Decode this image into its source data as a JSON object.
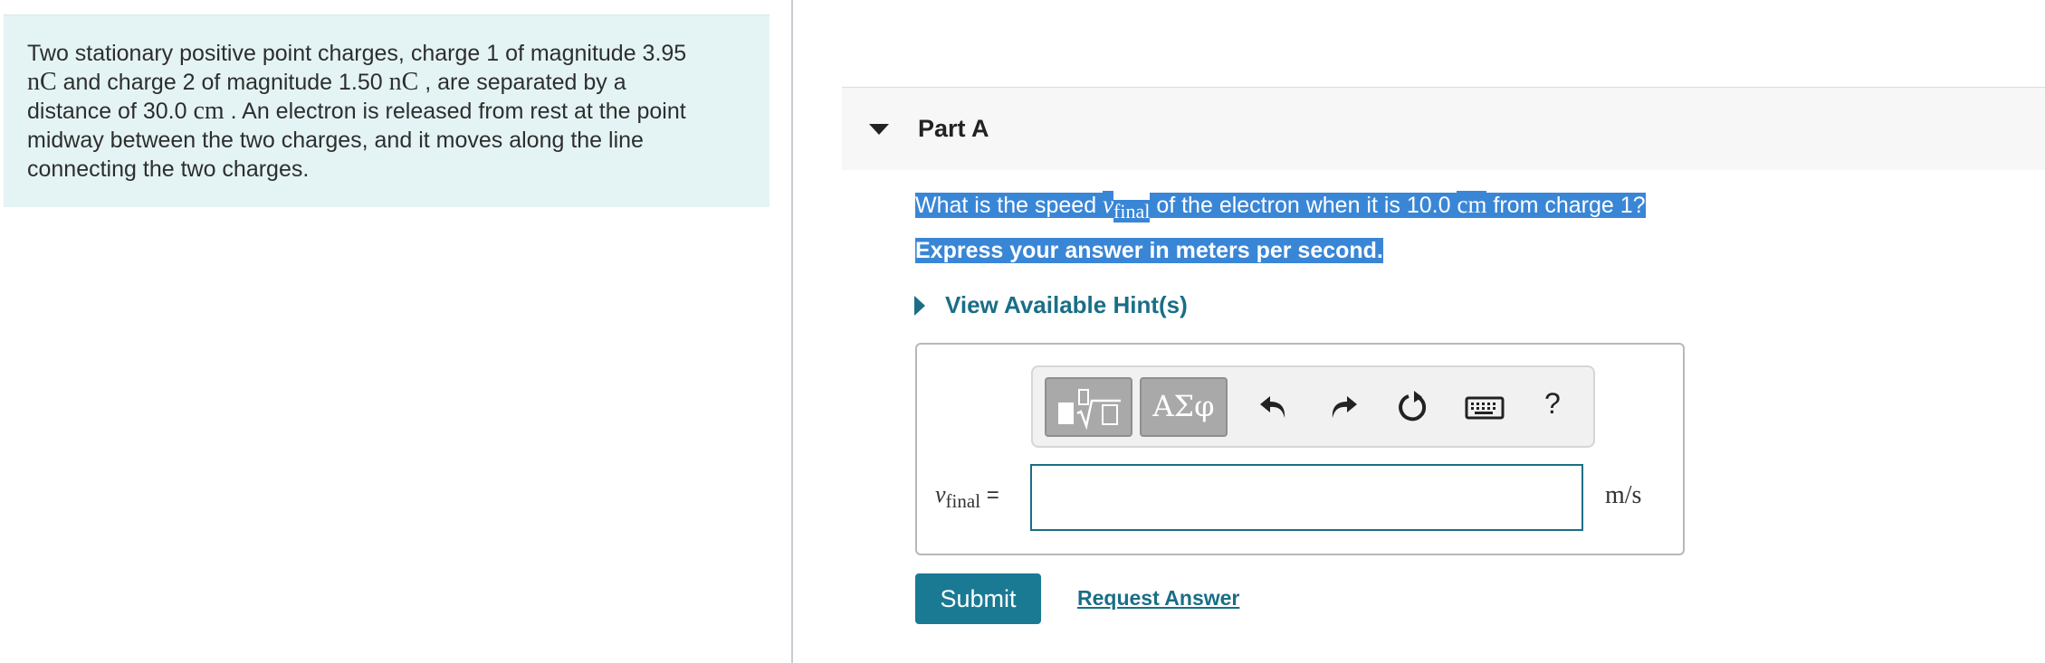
{
  "problem": {
    "text_1": "Two stationary positive point charges, charge 1 of magnitude 3.95",
    "unit_nC": "nC",
    "text_2": " and charge 2 of magnitude 1.50 ",
    "text_3": " , are separated by a",
    "text_4": "distance of 30.0 ",
    "unit_cm": "cm",
    "text_5": " . An electron is released from rest at the point",
    "text_6": "midway between the two charges, and it moves along the line",
    "text_7": "connecting the two charges."
  },
  "part": {
    "title": "Part A",
    "question_pre": "What is the speed ",
    "var_v": "v",
    "var_sub": "final",
    "question_mid": " of the electron when it is 10.0 ",
    "question_unit": "cm",
    "question_post": " from charge 1?",
    "express": "Express your answer in meters per second.",
    "hint_label": "View Available Hint(s)"
  },
  "answer": {
    "var_v": "v",
    "var_sub": "final",
    "equals": " =",
    "input_value": "",
    "unit": "m/s",
    "greek_label": "ΑΣφ",
    "help_label": "?"
  },
  "actions": {
    "submit_label": "Submit",
    "request_label": "Request Answer"
  },
  "colors": {
    "accent": "#1a7a93",
    "problem_bg": "#e4f4f5",
    "highlight": "#3a86d6"
  }
}
